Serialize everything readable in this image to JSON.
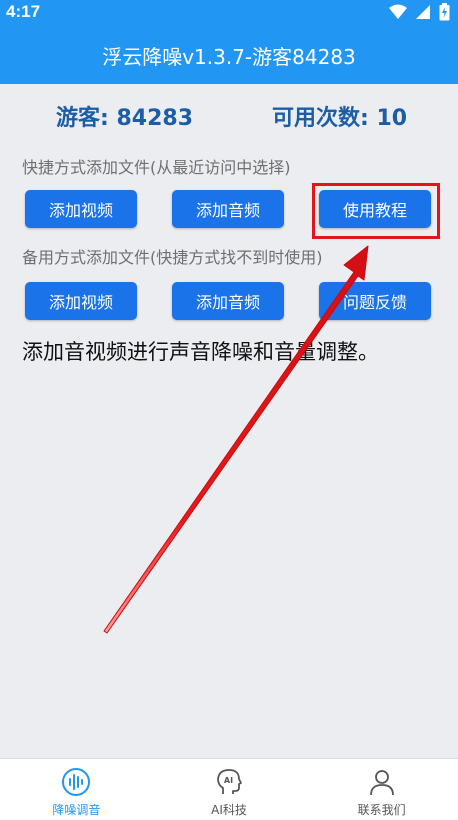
{
  "status_bar": {
    "time": "4:17"
  },
  "app_bar": {
    "title": "浮云降噪v1.3.7-游客84283"
  },
  "info": {
    "user_label": "游客: 84283",
    "usage_label": "可用次数: 10"
  },
  "section1": {
    "label": "快捷方式添加文件(从最近访问中选择)",
    "buttons": [
      "添加视频",
      "添加音频",
      "使用教程"
    ]
  },
  "section2": {
    "label": "备用方式添加文件(快捷方式找不到时使用)",
    "buttons": [
      "添加视频",
      "添加音频",
      "问题反馈"
    ]
  },
  "description": "添加音视频进行声音降噪和音量调整。",
  "bottom_nav": {
    "items": [
      {
        "label": "降噪调音",
        "icon": "waveform-icon",
        "active": true
      },
      {
        "label": "AI科技",
        "icon": "ai-head-icon",
        "active": false
      },
      {
        "label": "联系我们",
        "icon": "person-icon",
        "active": false
      }
    ]
  },
  "colors": {
    "primary": "#2196f3",
    "button": "#1a73e8",
    "accent_text": "#1c5ea6",
    "annotation_red": "#e3151a"
  }
}
